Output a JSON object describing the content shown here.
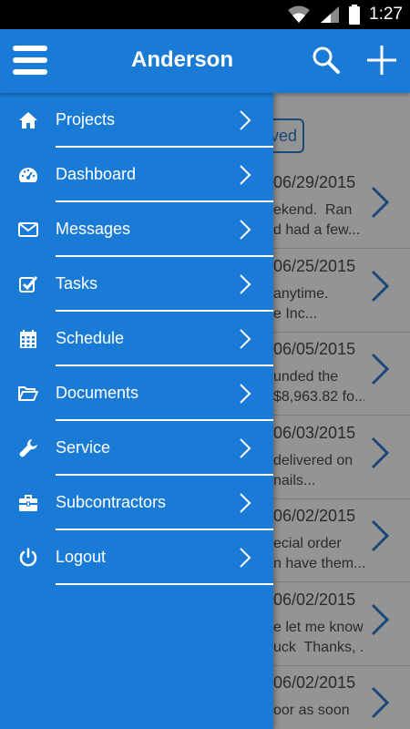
{
  "status_bar": {
    "time": "1:27"
  },
  "app_bar": {
    "title": "Anderson"
  },
  "content": {
    "filter_chip": "ved",
    "rows": [
      {
        "date": "06/29/2015",
        "preview": "ekend.  Ran\nd had a few..."
      },
      {
        "date": "06/25/2015",
        "preview": "anytime.\ne Inc..."
      },
      {
        "date": "06/05/2015",
        "preview": "unded the\n$8,963.82 fo..."
      },
      {
        "date": "06/03/2015",
        "preview": "delivered on\nnails..."
      },
      {
        "date": "06/02/2015",
        "preview": "ecial order\nn have them..."
      },
      {
        "date": "06/02/2015",
        "preview": "e let me know\nuck  Thanks, ..."
      },
      {
        "date": "06/02/2015",
        "preview": "oor as soon\n"
      }
    ]
  },
  "drawer": {
    "items": [
      {
        "label": "Projects",
        "icon": "home-icon"
      },
      {
        "label": "Dashboard",
        "icon": "dashboard-gauge-icon"
      },
      {
        "label": "Messages",
        "icon": "envelope-icon"
      },
      {
        "label": "Tasks",
        "icon": "checkbox-icon"
      },
      {
        "label": "Schedule",
        "icon": "calendar-icon"
      },
      {
        "label": "Documents",
        "icon": "folder-open-icon"
      },
      {
        "label": "Service",
        "icon": "wrench-icon"
      },
      {
        "label": "Subcontractors",
        "icon": "briefcase-icon"
      },
      {
        "label": "Logout",
        "icon": "power-icon"
      }
    ]
  },
  "colors": {
    "primary": "#1a7bd6",
    "accent": "#2f7dd1",
    "status_bar": "#000000"
  }
}
